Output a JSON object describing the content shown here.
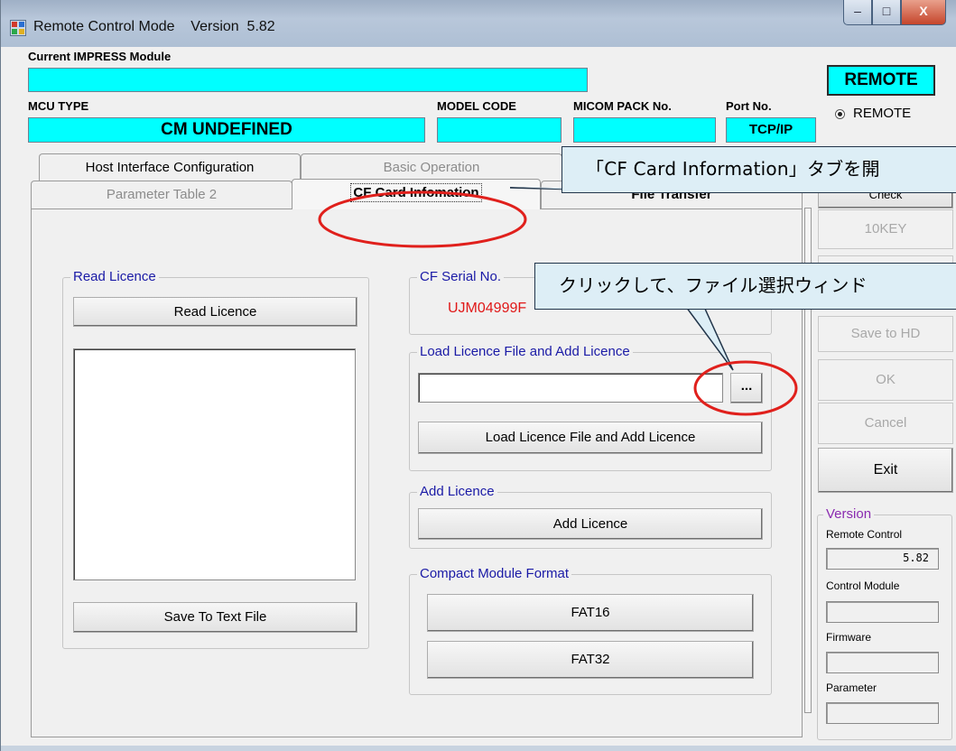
{
  "window": {
    "title": "Remote Control Mode    Version  5.82",
    "minimize": "–",
    "maximize": "□",
    "close": "X"
  },
  "header": {
    "current_module_label": "Current IMPRESS Module",
    "current_module_value": "",
    "mode_box": "REMOTE",
    "mcu_type_label": "MCU TYPE",
    "mcu_type_value": "CM UNDEFINED",
    "model_code_label": "MODEL CODE",
    "micom_pack_label": "MICOM PACK No.",
    "port_label": "Port No.",
    "port_value": "TCP/IP",
    "radio_remote": "REMOTE"
  },
  "tabs": {
    "host_interface": "Host Interface Configuration",
    "basic_operation": "Basic Operation",
    "parameter_table_2": "Parameter Table 2",
    "cf_card": "CF Card Infomation",
    "file_transfer": "File Transfer"
  },
  "read_licence": {
    "group_title": "Read Licence",
    "button": "Read Licence",
    "save_button": "Save To Text File"
  },
  "cf_serial": {
    "group_title": "CF Serial No.",
    "value": "UJM04999F"
  },
  "load_licence": {
    "group_title": "Load Licence File and Add Licence",
    "file_path": "",
    "browse_button": "...",
    "button": "Load Licence File and Add Licence"
  },
  "add_licence": {
    "group_title": "Add Licence",
    "button": "Add Licence"
  },
  "format": {
    "group_title": "Compact Module Format",
    "fat16": "FAT16",
    "fat32": "FAT32"
  },
  "right_panel": {
    "check": "Check",
    "tenkey": "10KEY",
    "save_to_hd": "Save to HD",
    "ok": "OK",
    "cancel": "Cancel",
    "exit": "Exit",
    "version_title": "Version",
    "remote_control_label": "Remote Control",
    "remote_control_value": "5.82",
    "control_module_label": "Control Module",
    "control_module_value": "",
    "firmware_label": "Firmware",
    "firmware_value": "",
    "parameter_label": "Parameter",
    "parameter_value": ""
  },
  "annotations": {
    "callout_tab": "「CF Card Information」タブを開",
    "callout_browse": "クリックして、ファイル選択ウィンド",
    "highlight_color": "#e0201c"
  }
}
